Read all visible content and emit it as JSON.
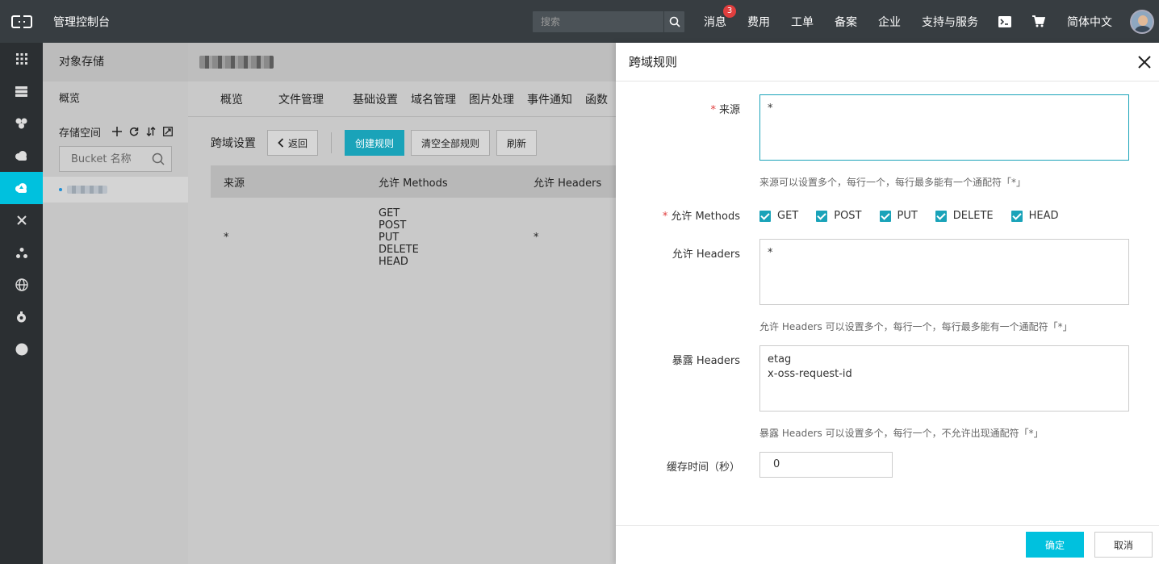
{
  "topbar": {
    "title": "管理控制台",
    "search_placeholder": "搜索",
    "nav": [
      "消息",
      "费用",
      "工单",
      "备案",
      "企业",
      "支持与服务"
    ],
    "message_badge": "3",
    "language": "简体中文"
  },
  "sidebar": {
    "title": "对象存储",
    "overview": "概览",
    "storage_space": "存储空间",
    "bucket_search_placeholder": "Bucket 名称"
  },
  "main": {
    "tabs": [
      "概览",
      "文件管理",
      "基础设置",
      "域名管理",
      "图片处理",
      "事件通知",
      "函数"
    ],
    "section_label": "跨域设置",
    "back_button": "返回",
    "create_button": "创建规则",
    "clear_button": "清空全部规则",
    "refresh_button": "刷新",
    "table": {
      "headers": [
        "来源",
        "允许 Methods",
        "允许 Headers"
      ],
      "rows": [
        {
          "origin": "*",
          "methods": [
            "GET",
            "POST",
            "PUT",
            "DELETE",
            "HEAD"
          ],
          "headers": "*"
        }
      ]
    }
  },
  "dialog": {
    "title": "跨域规则",
    "origin_label": "来源",
    "origin_value": "*",
    "origin_hint": "来源可以设置多个，每行一个，每行最多能有一个通配符「*」",
    "methods_label": "允许 Methods",
    "methods": [
      "GET",
      "POST",
      "PUT",
      "DELETE",
      "HEAD"
    ],
    "allow_headers_label": "允许 Headers",
    "allow_headers_value": "*",
    "allow_headers_hint": "允许 Headers 可以设置多个，每行一个，每行最多能有一个通配符「*」",
    "expose_headers_label": "暴露 Headers",
    "expose_headers_value": "etag\nx-oss-request-id",
    "expose_headers_hint": "暴露 Headers 可以设置多个，每行一个，不允许出现通配符「*」",
    "cache_label": "缓存时间（秒）",
    "cache_value": "0",
    "ok_button": "确定",
    "cancel_button": "取消"
  },
  "colors": {
    "accent": "#00c1de",
    "topbar": "#373d41",
    "required": "#e03e3e"
  }
}
